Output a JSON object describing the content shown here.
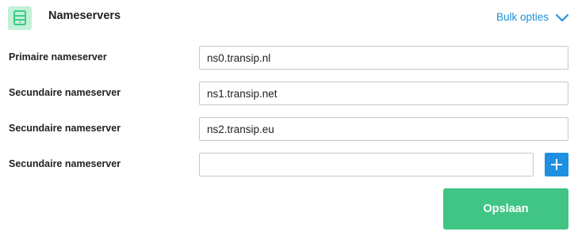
{
  "header": {
    "title": "Nameservers",
    "icon": "server-icon",
    "bulk_label": "Bulk opties",
    "bulk_icon": "chevron-down-icon"
  },
  "rows": [
    {
      "label": "Primaire nameserver",
      "value": "ns0.transip.nl",
      "placeholder": ""
    },
    {
      "label": "Secundaire nameserver",
      "value": "ns1.transip.net",
      "placeholder": ""
    },
    {
      "label": "Secundaire nameserver",
      "value": "ns2.transip.eu",
      "placeholder": ""
    },
    {
      "label": "Secundaire nameserver",
      "value": "",
      "placeholder": ""
    }
  ],
  "add_button": {
    "icon": "plus-icon"
  },
  "save_button": {
    "label": "Opslaan"
  },
  "colors": {
    "accent_blue": "#1a8fd6",
    "add_button_blue": "#1f8fe0",
    "save_green": "#40c585",
    "icon_bg": "#c2f0d8",
    "icon_fg": "#3ecb87"
  }
}
